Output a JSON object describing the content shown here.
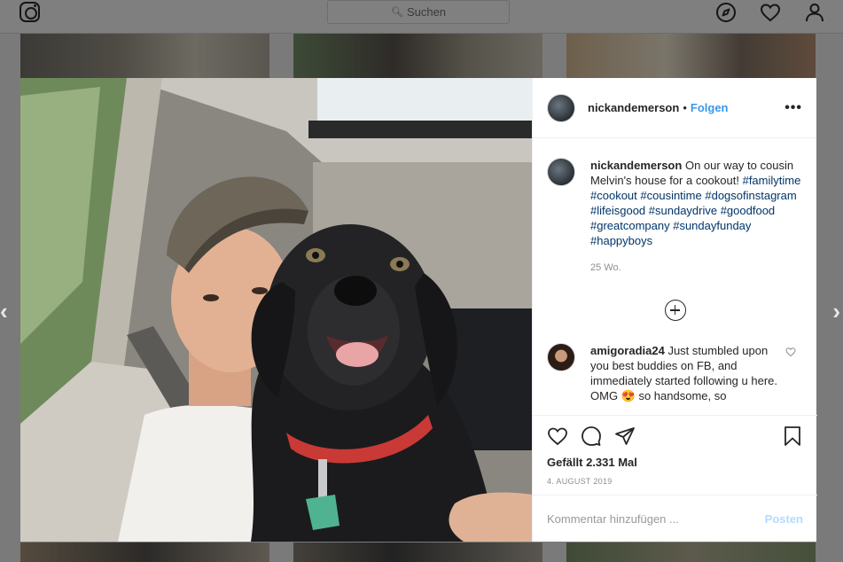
{
  "topnav": {
    "search_placeholder": "Suchen"
  },
  "nav_arrows": {
    "prev": "‹",
    "next": "›"
  },
  "post": {
    "username": "nickandemerson",
    "separator": "•",
    "follow_label": "Folgen",
    "more_label": "•••",
    "caption_text": "On our way to cousin Melvin's house for a cookout!",
    "hashtags": "#familytime #cookout #cousintime #dogsofinstagram #lifeisgood #sundaydrive #goodfood #greatcompany #sundayfunday #happyboys",
    "caption_time": "25 Wo.",
    "comment": {
      "username": "amigoradia24",
      "text": "Just stumbled upon you best buddies on FB, and immediately started following u here. OMG 😍 so handsome, so"
    },
    "likes": "Gefällt 2.331 Mal",
    "date": "4. AUGUST 2019",
    "comment_placeholder": "Kommentar hinzufügen ...",
    "post_button": "Posten"
  }
}
